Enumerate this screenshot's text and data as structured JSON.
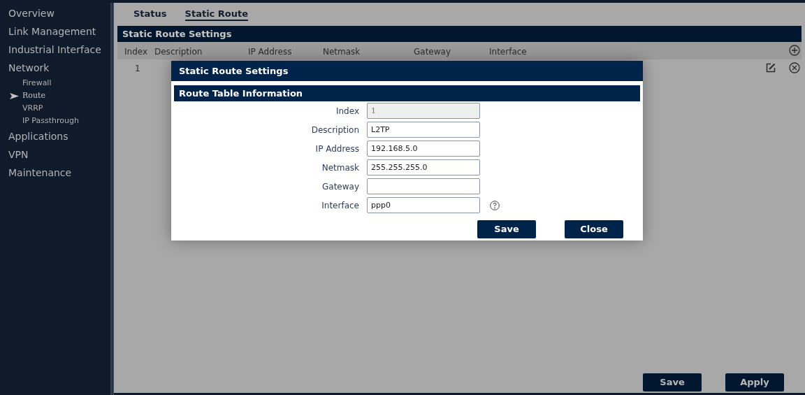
{
  "sidebar": {
    "items": [
      {
        "label": "Overview",
        "selected": false
      },
      {
        "label": "Link Management",
        "selected": false
      },
      {
        "label": "Industrial Interface",
        "selected": false
      },
      {
        "label": "Network",
        "selected": false,
        "children": [
          {
            "label": "Firewall",
            "selected": false
          },
          {
            "label": "Route",
            "selected": true
          },
          {
            "label": "VRRP",
            "selected": false
          },
          {
            "label": "IP Passthrough",
            "selected": false
          }
        ]
      },
      {
        "label": "Applications",
        "selected": false
      },
      {
        "label": "VPN",
        "selected": false
      },
      {
        "label": "Maintenance",
        "selected": false
      }
    ]
  },
  "tabs": [
    {
      "label": "Status",
      "selected": false
    },
    {
      "label": "Static Route",
      "selected": true
    }
  ],
  "section": {
    "title": "Static Route Settings"
  },
  "table": {
    "columns": [
      "Index",
      "Description",
      "IP Address",
      "Netmask",
      "Gateway",
      "Interface"
    ],
    "rows": [
      {
        "index": "1"
      }
    ]
  },
  "dialog": {
    "title": "Static Route Settings",
    "section": "Route Table Information",
    "fields": [
      {
        "label": "Index",
        "value": "1",
        "disabled": true,
        "help": false
      },
      {
        "label": "Description",
        "value": "L2TP",
        "disabled": false,
        "help": false
      },
      {
        "label": "IP Address",
        "value": "192.168.5.0",
        "disabled": false,
        "help": false
      },
      {
        "label": "Netmask",
        "value": "255.255.255.0",
        "disabled": false,
        "help": false
      },
      {
        "label": "Gateway",
        "disabled": false,
        "help": false
      },
      {
        "label": "Interface",
        "value": "ppp0",
        "disabled": false,
        "help": true
      }
    ],
    "buttons": [
      "Save",
      "Close"
    ]
  },
  "buttons": [
    "Save",
    "Apply"
  ]
}
